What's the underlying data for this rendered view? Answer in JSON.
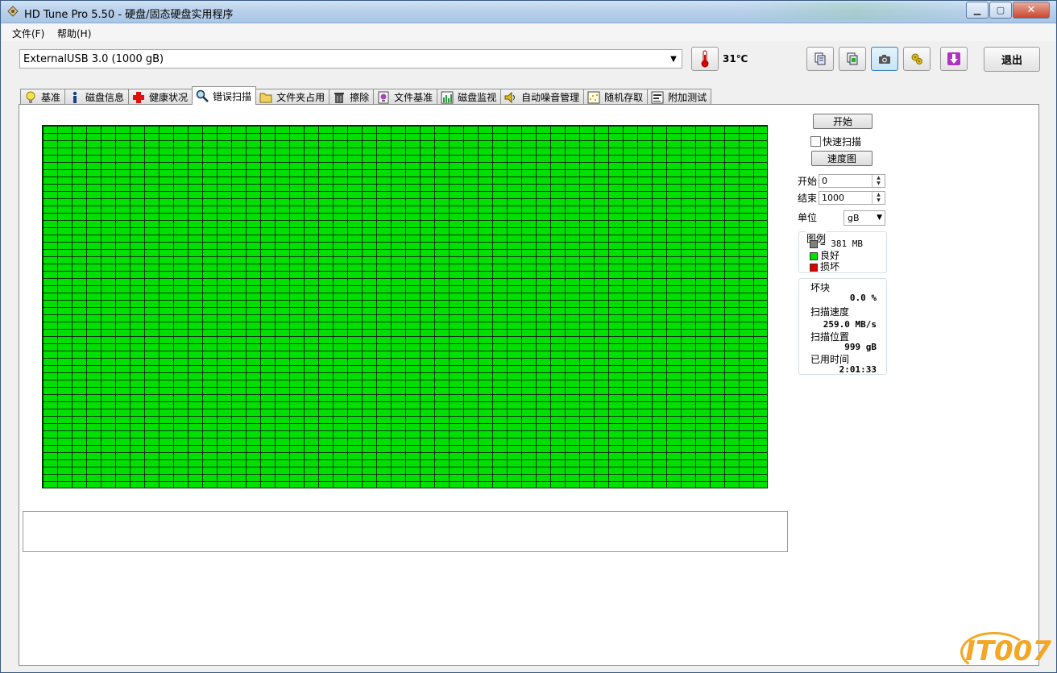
{
  "window": {
    "title": "HD Tune Pro 5.50 - 硬盘/固态硬盘实用程序"
  },
  "menu": {
    "file": "文件(F)",
    "help": "帮助(H)"
  },
  "toolbar": {
    "drive": "ExternalUSB 3.0 (1000 gB)",
    "temperature": "31℃",
    "exit_label": "退出",
    "buttons": [
      "copy-text-icon",
      "copy-info-icon",
      "screenshot-icon",
      "options-icon",
      "download-icon"
    ]
  },
  "tabs": [
    {
      "label": "基准",
      "icon": "lightbulb-icon"
    },
    {
      "label": "磁盘信息",
      "icon": "info-icon"
    },
    {
      "label": "健康状况",
      "icon": "health-cross-icon"
    },
    {
      "label": "错误扫描",
      "icon": "magnifier-icon",
      "active": true
    },
    {
      "label": "文件夹占用",
      "icon": "folder-icon"
    },
    {
      "label": "擦除",
      "icon": "trash-icon"
    },
    {
      "label": "文件基准",
      "icon": "file-benchmark-icon"
    },
    {
      "label": "磁盘监视",
      "icon": "monitor-chart-icon"
    },
    {
      "label": "自动噪音管理",
      "icon": "speaker-icon"
    },
    {
      "label": "随机存取",
      "icon": "random-access-icon"
    },
    {
      "label": "附加测试",
      "icon": "extra-tests-icon"
    }
  ],
  "scan": {
    "start_button": "开始",
    "quick_scan_label": "快速扫描",
    "quick_scan_checked": false,
    "speed_map_button": "速度图",
    "start_label": "开始",
    "start_value": "0",
    "end_label": "结束",
    "end_value": "1000",
    "unit_label": "单位",
    "unit_value": "gB",
    "block_status": "good"
  },
  "legend": {
    "title": "图例",
    "block_size": "= 381 MB",
    "good": "良好",
    "bad": "损坏",
    "colors": {
      "block": "#808080",
      "good": "#00e000",
      "bad": "#e00000"
    }
  },
  "stats": {
    "bad_blocks_label": "坏块",
    "bad_blocks_value": "0.0 %",
    "scan_speed_label": "扫描速度",
    "scan_speed_value": "259.0 MB/s",
    "scan_position_label": "扫描位置",
    "scan_position_value": "999 gB",
    "elapsed_label": "已用时间",
    "elapsed_value": "2:01:33"
  },
  "watermark": "IT007"
}
